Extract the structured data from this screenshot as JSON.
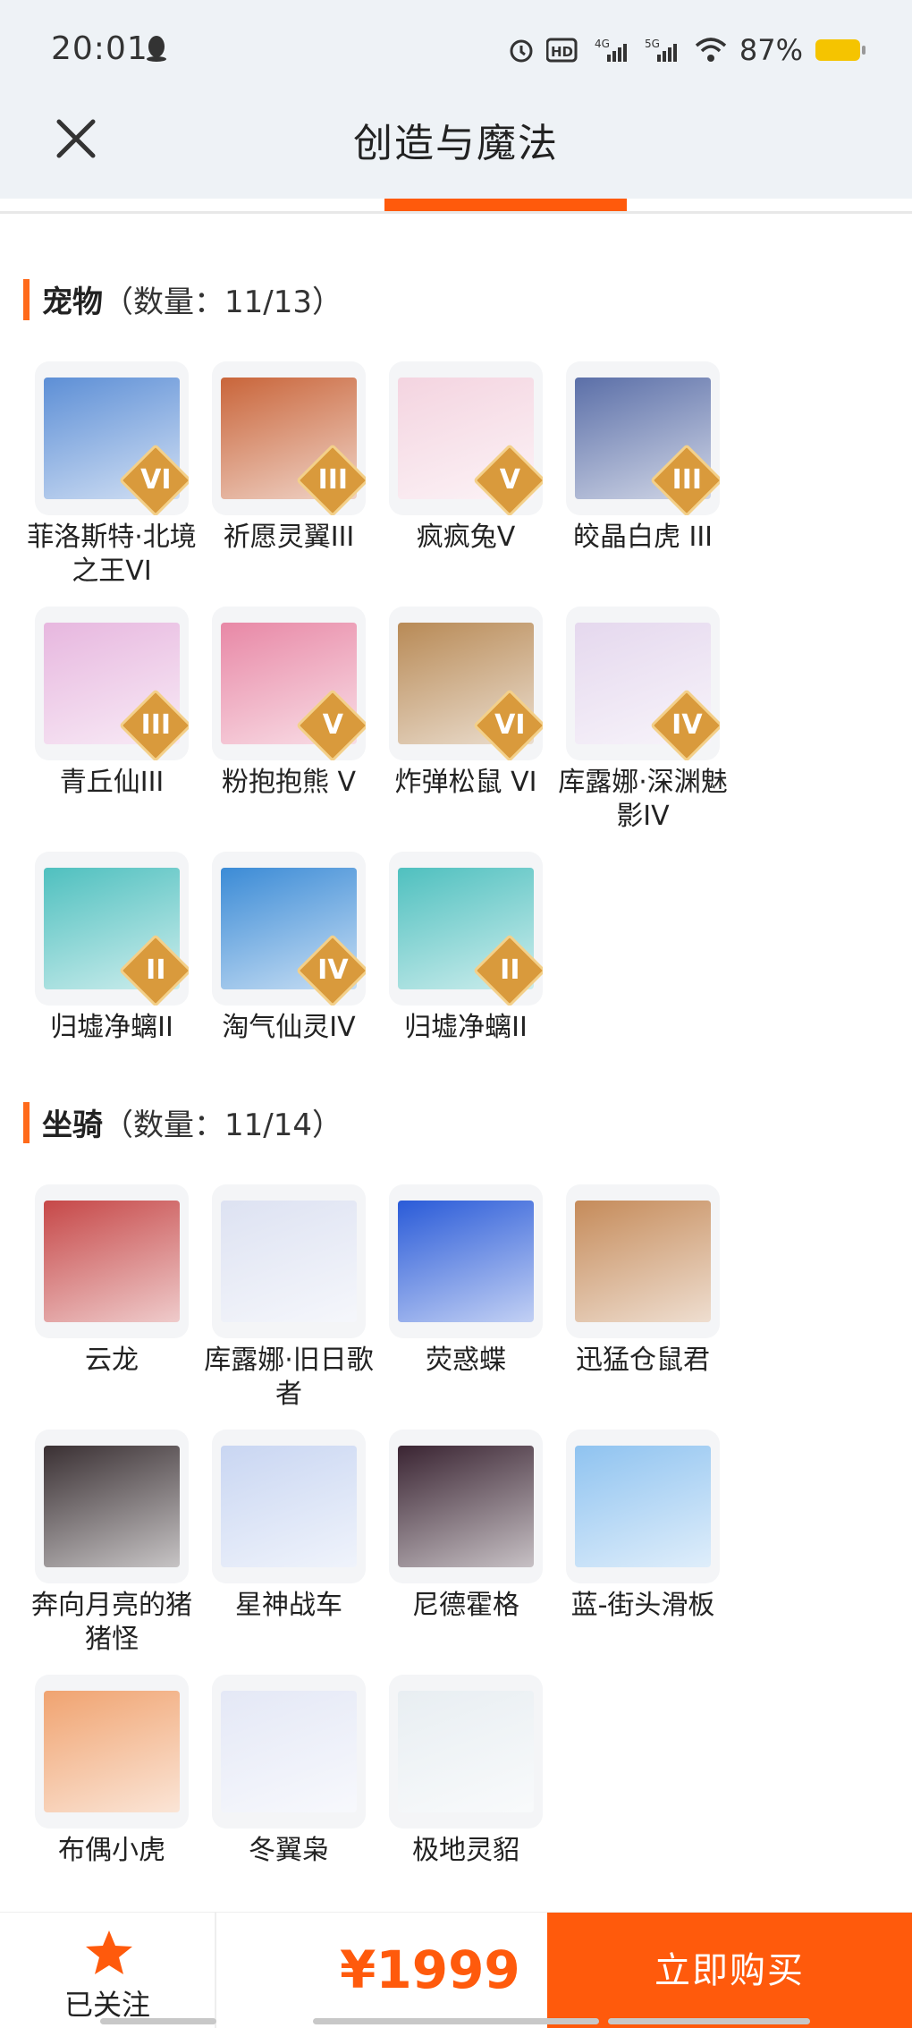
{
  "status": {
    "time": "20:01",
    "battery": "87%"
  },
  "header": {
    "title": "创造与魔法"
  },
  "pets": {
    "name": "宠物",
    "count": "（数量：11/13）",
    "items": [
      {
        "label": "菲洛斯特·北境之王VI",
        "badge": "VI",
        "color": "#5d8fd6"
      },
      {
        "label": "祈愿灵翼III",
        "badge": "III",
        "color": "#c9653a"
      },
      {
        "label": "疯疯兔V",
        "badge": "V",
        "color": "#f4d4e0"
      },
      {
        "label": "皎晶白虎 III",
        "badge": "III",
        "color": "#5b6fa8"
      },
      {
        "label": "青丘仙III",
        "badge": "III",
        "color": "#e7b7df"
      },
      {
        "label": "粉抱抱熊 V",
        "badge": "V",
        "color": "#e888a6"
      },
      {
        "label": "炸弹松鼠 VI",
        "badge": "VI",
        "color": "#b88a56"
      },
      {
        "label": "库露娜·深渊魅影IV",
        "badge": "IV",
        "color": "#e5d8ee"
      },
      {
        "label": "归墟净螭II",
        "badge": "II",
        "color": "#4fc0bf"
      },
      {
        "label": "淘气仙灵IV",
        "badge": "IV",
        "color": "#3b8bd6"
      },
      {
        "label": "归墟净螭II",
        "badge": "II",
        "color": "#4fc0bf"
      }
    ]
  },
  "mounts": {
    "name": "坐骑",
    "count": "（数量：11/14）",
    "items": [
      {
        "label": "云龙",
        "color": "#c64848"
      },
      {
        "label": "库露娜·旧日歌者",
        "color": "#dde2f2"
      },
      {
        "label": "荧惑蝶",
        "color": "#2a5bd8"
      },
      {
        "label": "迅猛仓鼠君",
        "color": "#c58b5a"
      },
      {
        "label": "奔向月亮的猪猪怪",
        "color": "#3a3033"
      },
      {
        "label": "星神战车",
        "color": "#c9d6f2"
      },
      {
        "label": "尼德霍格",
        "color": "#3a2432"
      },
      {
        "label": "蓝-街头滑板",
        "color": "#8fc3f0"
      },
      {
        "label": "布偶小虎",
        "color": "#f0a370"
      },
      {
        "label": "冬翼枭",
        "color": "#e4e8f6"
      },
      {
        "label": "极地灵貂",
        "color": "#e8eef2"
      }
    ]
  },
  "footer": {
    "follow_label": "已关注",
    "price": "¥1999",
    "buy_label": "立即购买"
  }
}
